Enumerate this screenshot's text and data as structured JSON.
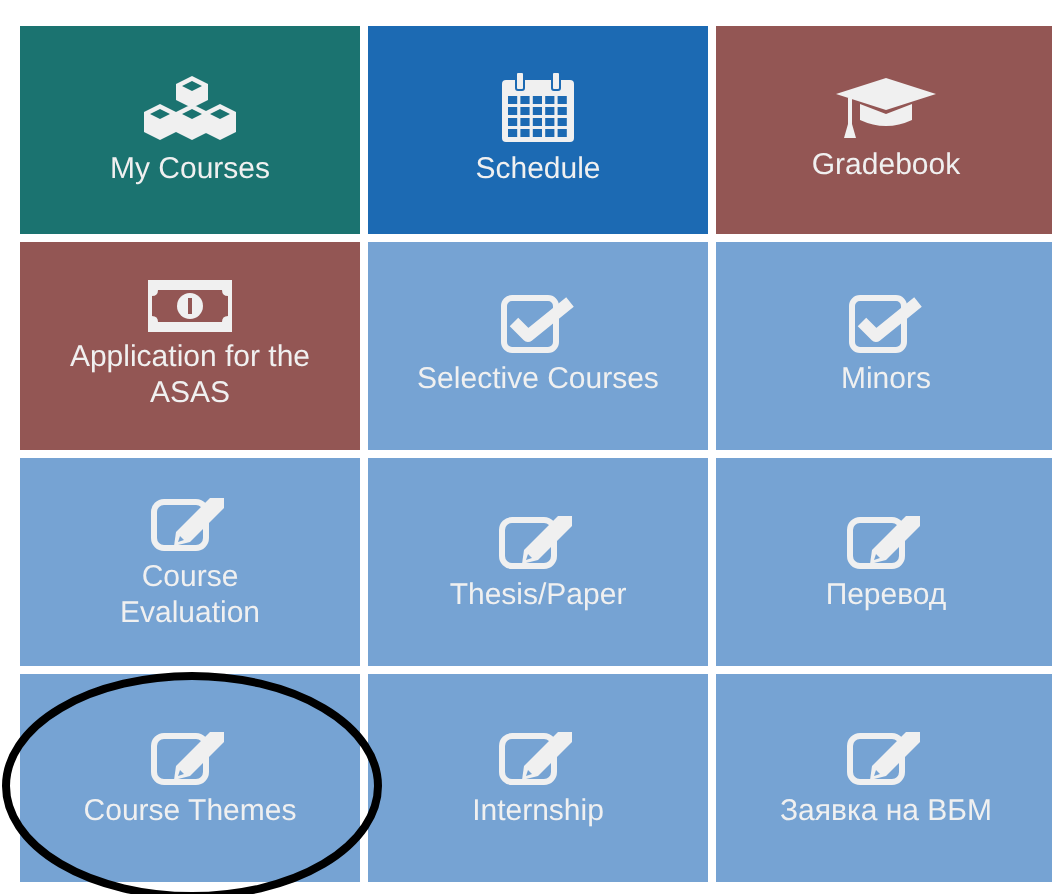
{
  "tiles": [
    {
      "label": "My Courses",
      "kind": "cubes",
      "color": "#1b7370",
      "circled": false
    },
    {
      "label": "Schedule",
      "kind": "calendar",
      "color": "#1c6ab3",
      "circled": false
    },
    {
      "label": "Gradebook",
      "kind": "cap",
      "color": "#935654",
      "circled": false
    },
    {
      "label": "Application for the ASAS",
      "kind": "money",
      "color": "#935654",
      "circled": false
    },
    {
      "label": "Selective Courses",
      "kind": "check",
      "color": "#76a3d3",
      "circled": false
    },
    {
      "label": "Minors",
      "kind": "check",
      "color": "#76a3d3",
      "circled": false
    },
    {
      "label": "Course Evaluation",
      "kind": "edit",
      "color": "#76a3d3",
      "circled": false
    },
    {
      "label": "Thesis/Paper",
      "kind": "edit",
      "color": "#76a3d3",
      "circled": false
    },
    {
      "label": "Перевод",
      "kind": "edit",
      "color": "#76a3d3",
      "circled": false
    },
    {
      "label": "Course Themes",
      "kind": "edit",
      "color": "#76a3d3",
      "circled": true
    },
    {
      "label": "Internship",
      "kind": "edit",
      "color": "#76a3d3",
      "circled": false
    },
    {
      "label": "Заявка на ВБМ",
      "kind": "edit",
      "color": "#76a3d3",
      "circled": false
    }
  ]
}
